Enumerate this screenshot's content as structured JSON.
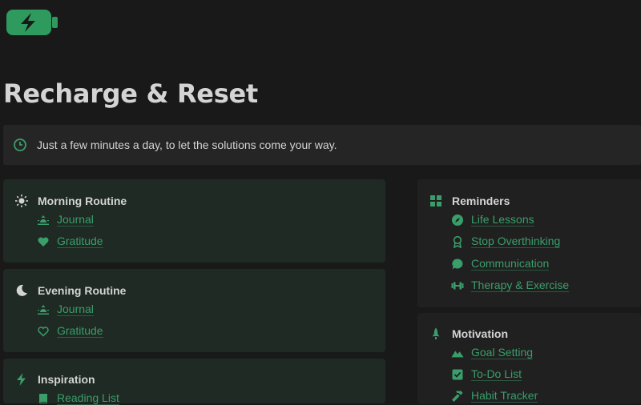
{
  "page": {
    "title": "Recharge & Reset",
    "callout": "Just a few minutes a day, to let the solutions come your way.",
    "accent_color": "#3a9e6a",
    "icons": {
      "header": "battery-charging-icon",
      "callout": "clock-icon"
    }
  },
  "left": {
    "morning": {
      "title": "Morning Routine",
      "icon": "sun-icon",
      "links": [
        {
          "label": "Journal",
          "icon": "sunrise-icon"
        },
        {
          "label": "Gratitude",
          "icon": "heart-filled-icon"
        }
      ]
    },
    "evening": {
      "title": "Evening Routine",
      "icon": "moon-icon",
      "links": [
        {
          "label": "Journal",
          "icon": "sunrise-icon"
        },
        {
          "label": "Gratitude",
          "icon": "heart-outline-icon"
        }
      ]
    },
    "inspiration": {
      "title": "Inspiration",
      "icon": "bolt-icon",
      "links": [
        {
          "label": "Reading List",
          "icon": "book-icon"
        }
      ]
    }
  },
  "right": {
    "reminders": {
      "title": "Reminders",
      "icon": "grid-icon",
      "links": [
        {
          "label": "Life Lessons",
          "icon": "compass-icon"
        },
        {
          "label": "Stop Overthinking",
          "icon": "award-icon"
        },
        {
          "label": "Communication",
          "icon": "chat-bubble-icon"
        },
        {
          "label": "Therapy & Exercise",
          "icon": "dumbbell-icon"
        }
      ]
    },
    "motivation": {
      "title": "Motivation",
      "icon": "rocket-icon",
      "links": [
        {
          "label": "Goal Setting",
          "icon": "mountain-icon"
        },
        {
          "label": "To-Do List",
          "icon": "checkbox-icon"
        },
        {
          "label": "Habit Tracker",
          "icon": "hammer-icon"
        }
      ]
    }
  }
}
